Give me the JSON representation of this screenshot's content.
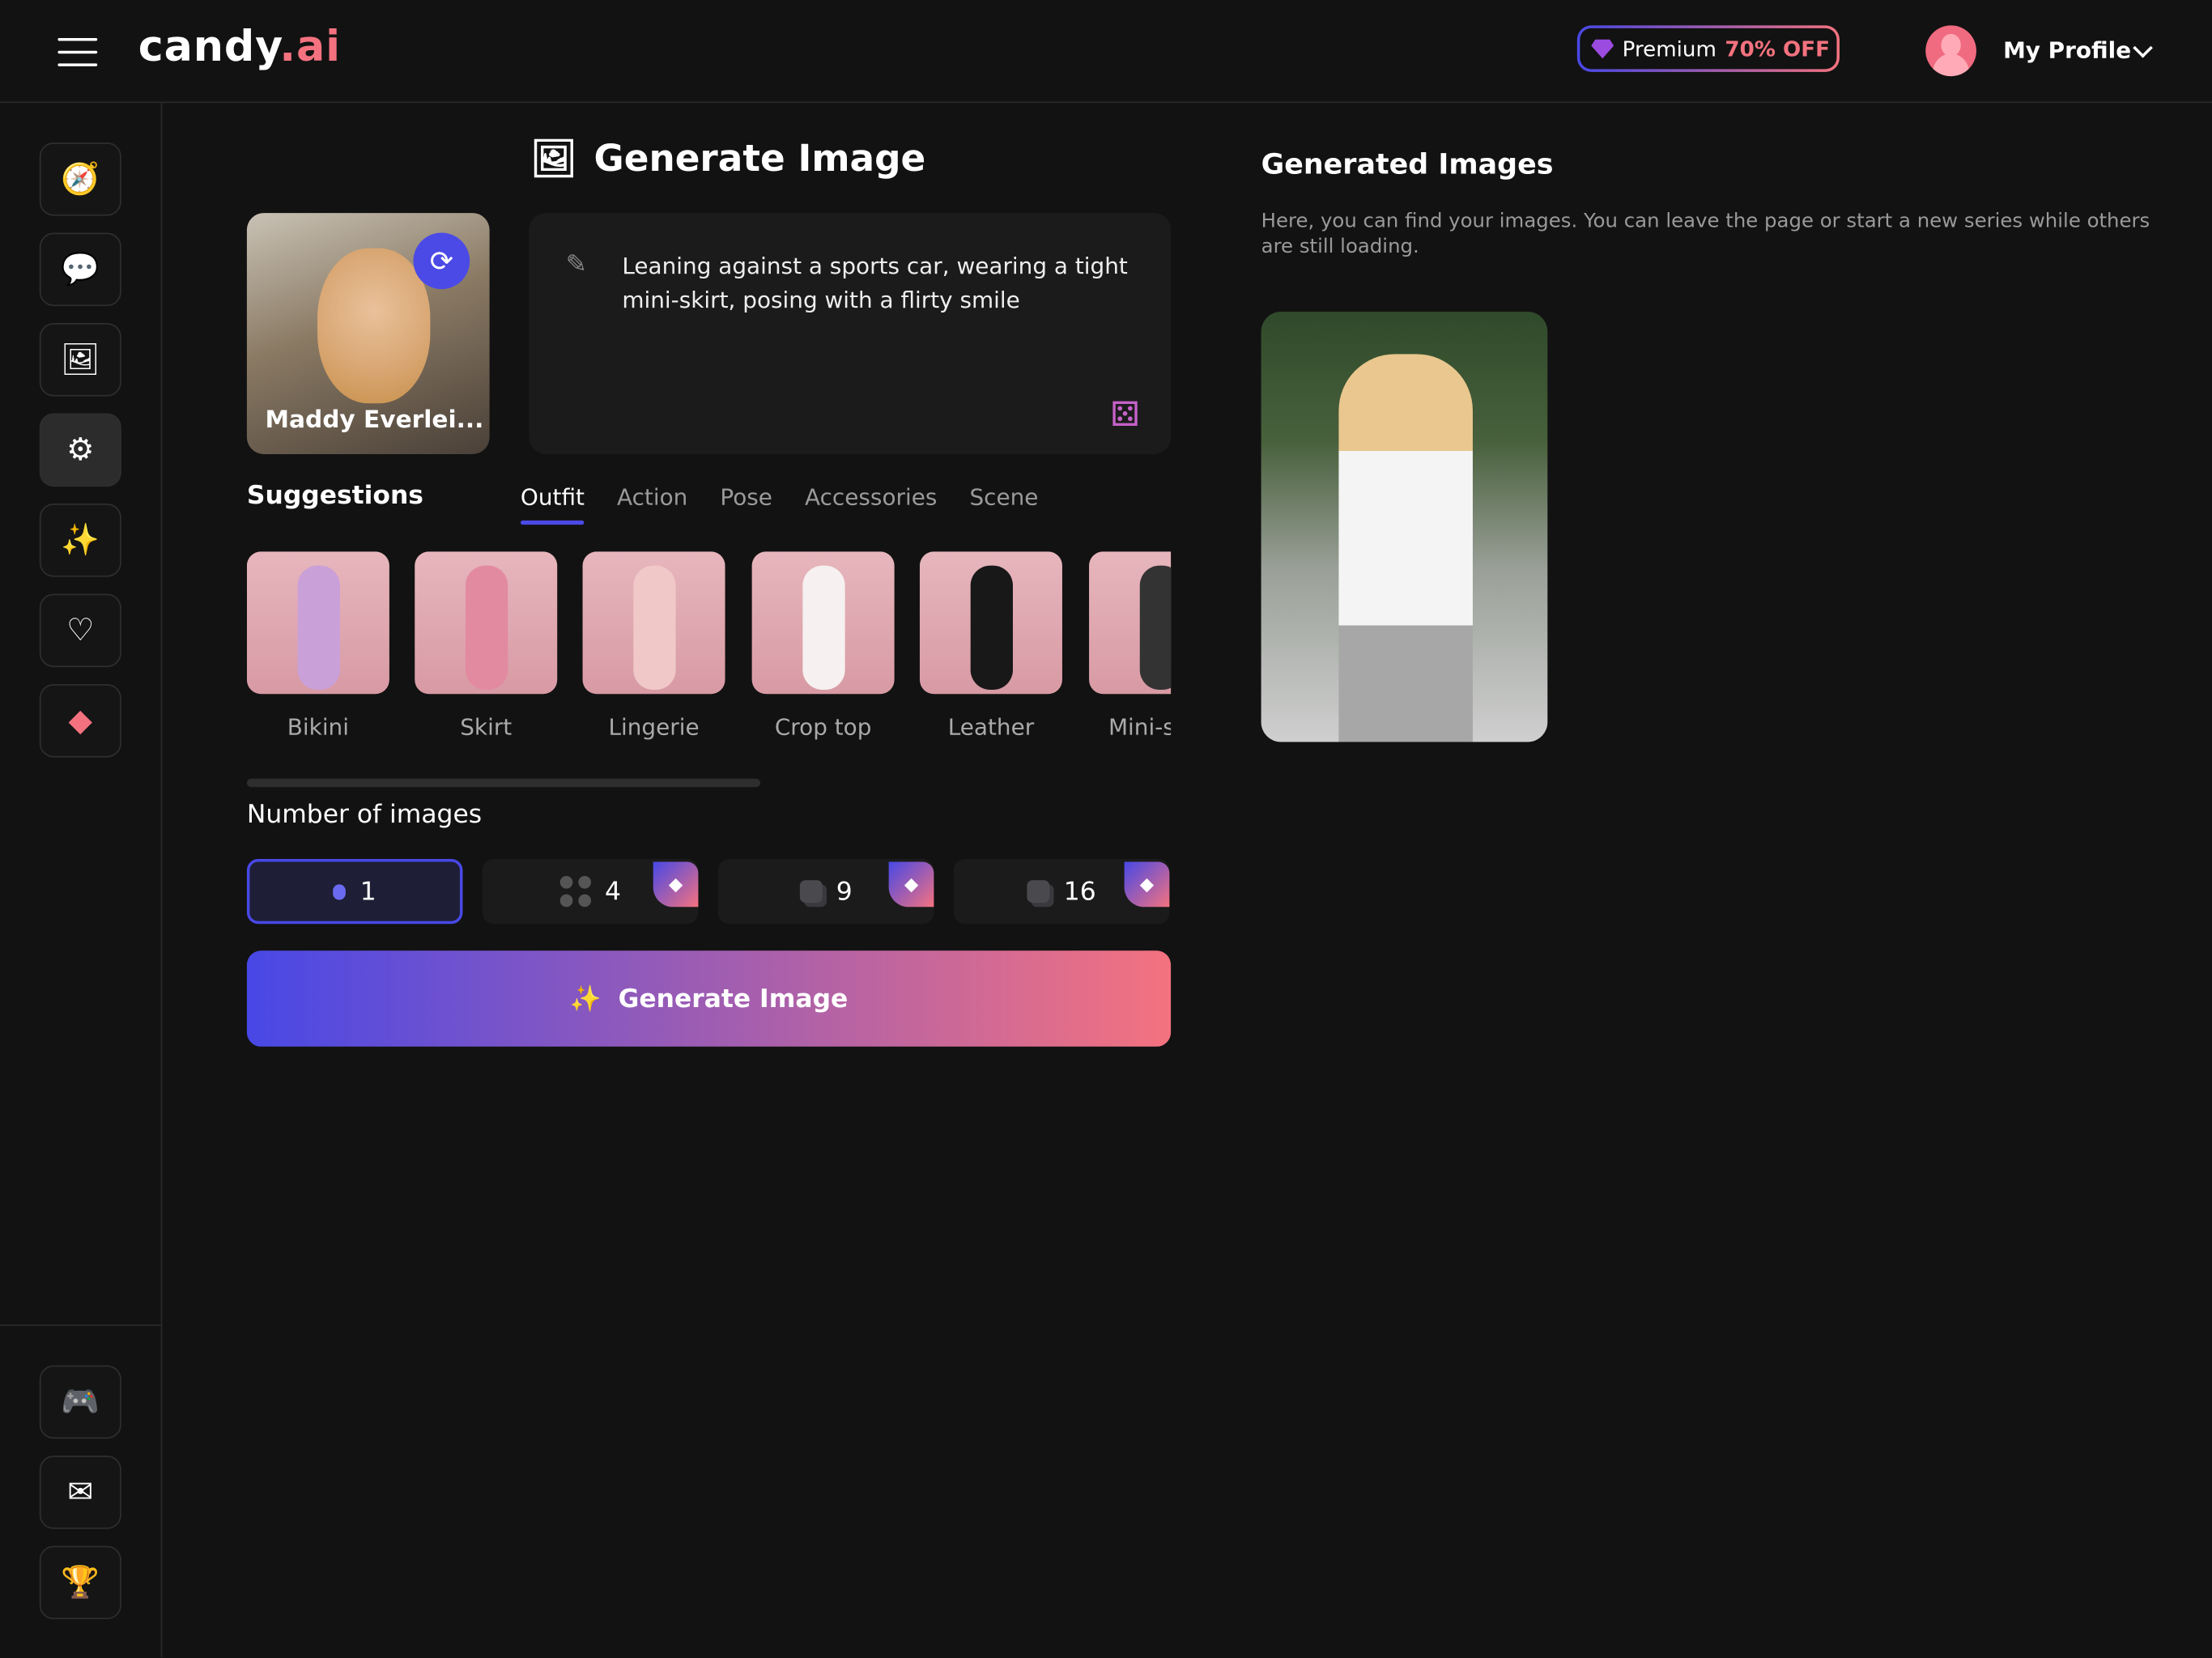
{
  "header": {
    "logo_main": "candy",
    "logo_accent": ".ai",
    "premium_label": "Premium",
    "premium_offer": "70% OFF",
    "profile_label": "My Profile"
  },
  "sidebar": {
    "items": [
      {
        "icon": "compass-icon"
      },
      {
        "icon": "chat-icon"
      },
      {
        "icon": "gallery-icon"
      },
      {
        "icon": "ai-generate-icon",
        "active": true
      },
      {
        "icon": "magic-wand-icon"
      },
      {
        "icon": "heart-icon"
      },
      {
        "icon": "diamond-icon"
      }
    ],
    "bottom": [
      {
        "icon": "discord-icon"
      },
      {
        "icon": "contact-icon"
      },
      {
        "icon": "trophy-icon"
      }
    ]
  },
  "main": {
    "title": "Generate Image",
    "character_name": "Maddy Everlei...",
    "prompt": "Leaning against a sports car, wearing a tight mini-skirt, posing with a flirty smile",
    "suggestions_label": "Suggestions",
    "tabs": [
      "Outfit",
      "Action",
      "Pose",
      "Accessories",
      "Scene"
    ],
    "active_tab": "Outfit",
    "outfits": [
      "Bikini",
      "Skirt",
      "Lingerie",
      "Crop top",
      "Leather",
      "Mini-skirt"
    ],
    "number_label": "Number of images",
    "counts": [
      "1",
      "4",
      "9",
      "16"
    ],
    "selected_count": "1",
    "generate_label": "Generate Image"
  },
  "generated": {
    "title": "Generated Images",
    "description": "Here, you can find your images. You can leave the page or start a new series while others are still loading."
  },
  "colors": {
    "accent_blue": "#4848e6",
    "accent_pink": "#f4727f",
    "background": "#121212"
  }
}
